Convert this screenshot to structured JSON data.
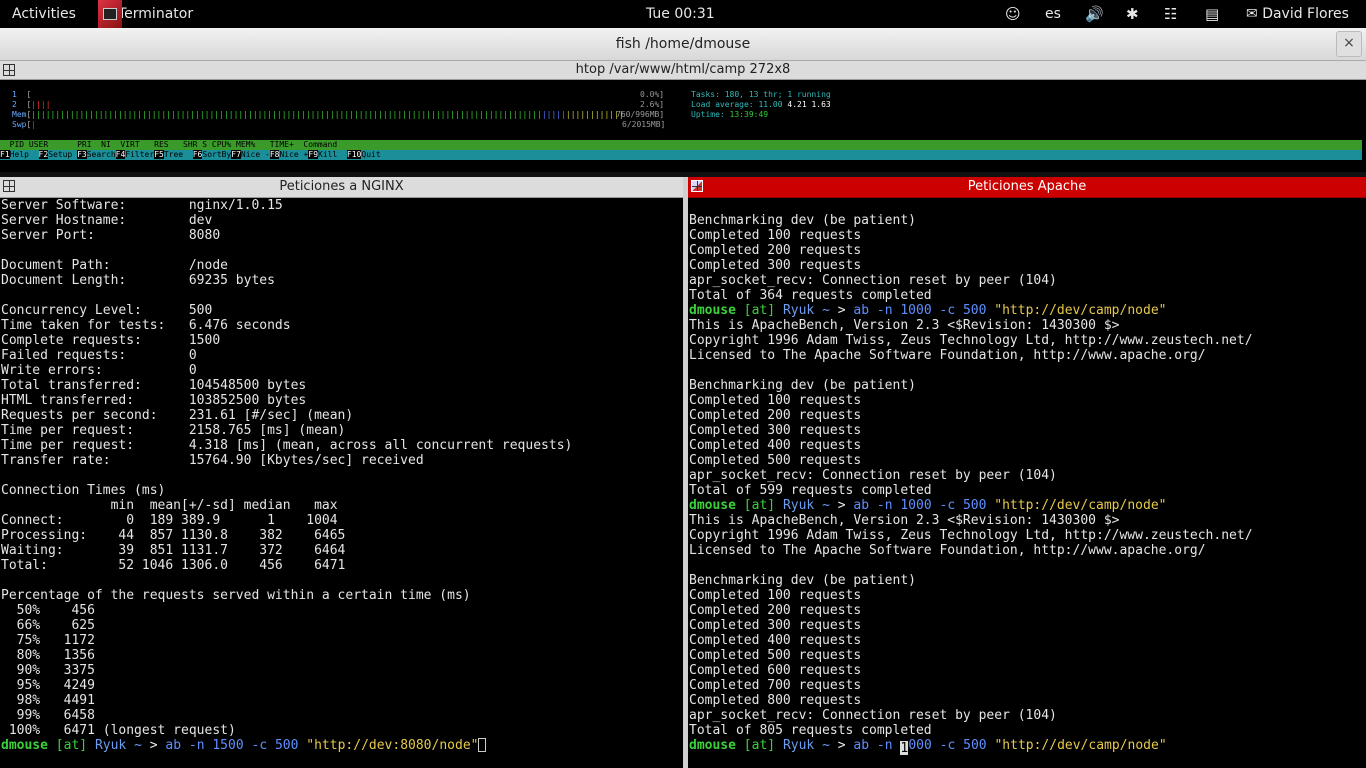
{
  "topbar": {
    "activities": "Activities",
    "app_name": "Terminator",
    "clock": "Tue 00:31",
    "keyboard_layout": "es",
    "user": "David Flores",
    "icons": [
      "accessibility-icon",
      "volume-icon",
      "bluetooth-icon",
      "wifi-icon",
      "clipboard-icon",
      "user-icon"
    ]
  },
  "window": {
    "title": "fish  /home/dmouse",
    "close": "×"
  },
  "htop_pane": {
    "title": "htop  /var/www/html/camp 272x8",
    "cpu1": {
      "label": "1",
      "value": "0.0%"
    },
    "cpu2": {
      "label": "2",
      "value": "2.6%"
    },
    "mem": {
      "label": "Mem",
      "value": "760/996MB"
    },
    "swp": {
      "label": "Swp",
      "value": "6/2015MB"
    },
    "tasks": {
      "label": "Tasks:",
      "value": "180, 13 thr; 1 running"
    },
    "load": {
      "label": "Load average:",
      "v1": "11.00",
      "v2": "4.21",
      "v3": "1.63"
    },
    "uptime": {
      "label": "Uptime:",
      "value": "13:39:49"
    },
    "columns": "  PID USER      PRI  NI  VIRT   RES   SHR S CPU% MEM%   TIME+  Command",
    "fkeys": [
      {
        "key": "F1",
        "label": "Help  "
      },
      {
        "key": "F2",
        "label": "Setup "
      },
      {
        "key": "F3",
        "label": "Search"
      },
      {
        "key": "F4",
        "label": "Filter"
      },
      {
        "key": "F5",
        "label": "Tree  "
      },
      {
        "key": "F6",
        "label": "SortBy"
      },
      {
        "key": "F7",
        "label": "Nice -"
      },
      {
        "key": "F8",
        "label": "Nice +"
      },
      {
        "key": "F9",
        "label": "Kill  "
      },
      {
        "key": "F10",
        "label": "Quit"
      }
    ]
  },
  "nginx_pane": {
    "title": "Peticiones a NGINX",
    "lines": [
      "Server Software:        nginx/1.0.15",
      "Server Hostname:        dev",
      "Server Port:            8080",
      "",
      "Document Path:          /node",
      "Document Length:        69235 bytes",
      "",
      "Concurrency Level:      500",
      "Time taken for tests:   6.476 seconds",
      "Complete requests:      1500",
      "Failed requests:        0",
      "Write errors:           0",
      "Total transferred:      104548500 bytes",
      "HTML transferred:       103852500 bytes",
      "Requests per second:    231.61 [#/sec] (mean)",
      "Time per request:       2158.765 [ms] (mean)",
      "Time per request:       4.318 [ms] (mean, across all concurrent requests)",
      "Transfer rate:          15764.90 [Kbytes/sec] received",
      "",
      "Connection Times (ms)",
      "              min  mean[+/-sd] median   max",
      "Connect:        0  189 389.9      1    1004",
      "Processing:    44  857 1130.8    382    6465",
      "Waiting:       39  851 1131.7    372    6464",
      "Total:         52 1046 1306.0    456    6471",
      "",
      "Percentage of the requests served within a certain time (ms)",
      "  50%    456",
      "  66%    625",
      "  75%   1172",
      "  80%   1356",
      "  90%   3375",
      "  95%   4249",
      "  98%   4491",
      "  99%   6458",
      " 100%   6471 (longest request)"
    ],
    "prompt": {
      "user": "dmouse",
      "at": "[at]",
      "host": "Ryuk",
      "path": "~",
      "arrow": ">",
      "cmd": "ab",
      "args": "-n 1500 -c 500",
      "url": "\"http://dev:8080/node\""
    }
  },
  "apache_pane": {
    "title": "Peticiones Apache",
    "blocks": [
      {
        "type": "text",
        "lines": [
          "",
          "Benchmarking dev (be patient)",
          "Completed 100 requests",
          "Completed 200 requests",
          "Completed 300 requests",
          "apr_socket_recv: Connection reset by peer (104)",
          "Total of 364 requests completed"
        ]
      },
      {
        "type": "prompt",
        "user": "dmouse",
        "at": "[at]",
        "host": "Ryuk",
        "path": "~",
        "arrow": ">",
        "cmd": "ab",
        "args": "-n 1000 -c 500",
        "url": "\"http://dev/camp/node\""
      },
      {
        "type": "text",
        "lines": [
          "This is ApacheBench, Version 2.3 <$Revision: 1430300 $>",
          "Copyright 1996 Adam Twiss, Zeus Technology Ltd, http://www.zeustech.net/",
          "Licensed to The Apache Software Foundation, http://www.apache.org/",
          "",
          "Benchmarking dev (be patient)",
          "Completed 100 requests",
          "Completed 200 requests",
          "Completed 300 requests",
          "Completed 400 requests",
          "Completed 500 requests",
          "apr_socket_recv: Connection reset by peer (104)",
          "Total of 599 requests completed"
        ]
      },
      {
        "type": "prompt",
        "user": "dmouse",
        "at": "[at]",
        "host": "Ryuk",
        "path": "~",
        "arrow": ">",
        "cmd": "ab",
        "args": "-n 1000 -c 500",
        "url": "\"http://dev/camp/node\""
      },
      {
        "type": "text",
        "lines": [
          "This is ApacheBench, Version 2.3 <$Revision: 1430300 $>",
          "Copyright 1996 Adam Twiss, Zeus Technology Ltd, http://www.zeustech.net/",
          "Licensed to The Apache Software Foundation, http://www.apache.org/",
          "",
          "Benchmarking dev (be patient)",
          "Completed 100 requests",
          "Completed 200 requests",
          "Completed 300 requests",
          "Completed 400 requests",
          "Completed 500 requests",
          "Completed 600 requests",
          "Completed 700 requests",
          "Completed 800 requests",
          "apr_socket_recv: Connection reset by peer (104)",
          "Total of 805 requests completed"
        ]
      }
    ],
    "prompt": {
      "user": "dmouse",
      "at": "[at]",
      "host": "Ryuk",
      "path": "~",
      "arrow": ">",
      "cmd": "ab",
      "args_pre": "-n ",
      "args_cursor": "1",
      "args_post": "000 -c 500",
      "url": "\"http://dev/camp/node\""
    }
  }
}
